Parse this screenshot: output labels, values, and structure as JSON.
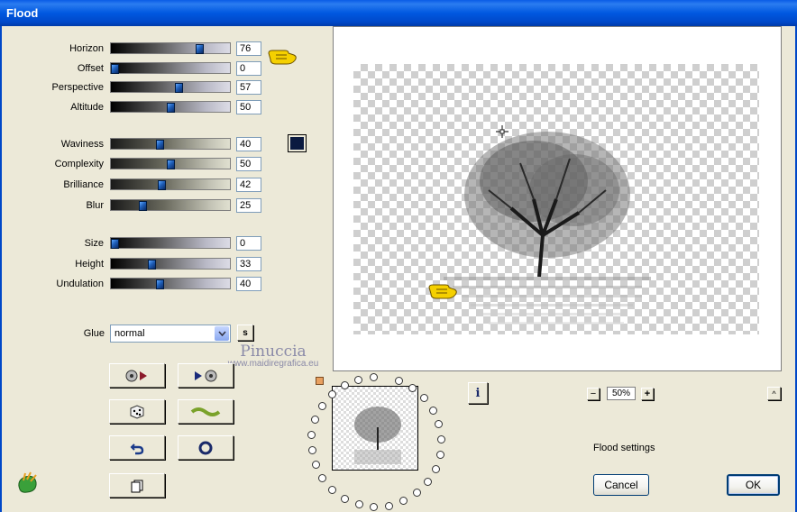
{
  "window": {
    "title": "Flood"
  },
  "sliders": [
    {
      "id": "horizon",
      "label": "Horizon",
      "value": "76",
      "level": 76,
      "style": "gray"
    },
    {
      "id": "offset",
      "label": "Offset",
      "value": "0",
      "level": 0,
      "style": "gray"
    },
    {
      "id": "perspective",
      "label": "Perspective",
      "value": "57",
      "level": 57,
      "style": "gray"
    },
    {
      "id": "altitude",
      "label": "Altitude",
      "value": "50",
      "level": 50,
      "style": "gray"
    },
    {
      "id": "waviness",
      "label": "Waviness",
      "value": "40",
      "level": 40,
      "style": "olive"
    },
    {
      "id": "complexity",
      "label": "Complexity",
      "value": "50",
      "level": 50,
      "style": "olive"
    },
    {
      "id": "brilliance",
      "label": "Brilliance",
      "value": "42",
      "level": 42,
      "style": "olive"
    },
    {
      "id": "blur",
      "label": "Blur",
      "value": "25",
      "level": 25,
      "style": "olive"
    },
    {
      "id": "size",
      "label": "Size",
      "value": "0",
      "level": 0,
      "style": "gray"
    },
    {
      "id": "height",
      "label": "Height",
      "value": "33",
      "level": 33,
      "style": "gray"
    },
    {
      "id": "undulation",
      "label": "Undulation",
      "value": "40",
      "level": 40,
      "style": "gray"
    }
  ],
  "color_swatch": "#0a1a40",
  "glue": {
    "label": "Glue",
    "selected": "normal",
    "s_button": "s"
  },
  "watermark": {
    "line1": "Pinuccia",
    "line2": "www.maidiregrafica.eu"
  },
  "zoom": {
    "value": "50%",
    "minus": "−",
    "plus": "+"
  },
  "info_label": "i",
  "collapse_label": "^",
  "settings_label": "Flood settings",
  "buttons": {
    "cancel": "Cancel",
    "ok": "OK"
  },
  "colors": {
    "title_bar": "#0058e0",
    "dialog_bg": "#ece9d8",
    "thumb": "#1f5fb8"
  }
}
